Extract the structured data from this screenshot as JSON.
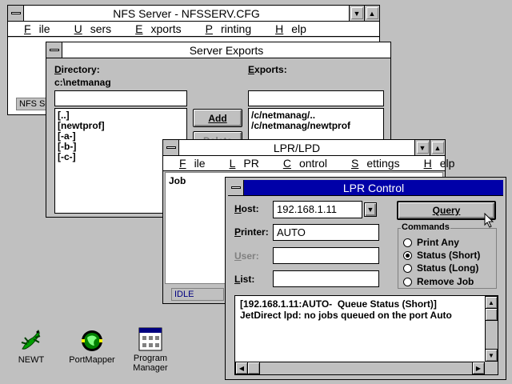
{
  "nfs": {
    "title": "NFS Server - NFSSERV.CFG",
    "menu": [
      "File",
      "Users",
      "Exports",
      "Printing",
      "Help"
    ],
    "status": "NFS Se"
  },
  "exports": {
    "title": "Server Exports",
    "directory_label": "Directory:",
    "directory_path": "c:\\netmanag",
    "directory_input": "",
    "exports_label": "Exports:",
    "exports_input": "",
    "directories": [
      "[..]",
      "[newtprof]",
      "[-a-]",
      "[-b-]",
      "[-c-]"
    ],
    "export_items": [
      "/c/netmanag/..",
      "/c/netmanag/newtprof"
    ],
    "add_label": "Add",
    "delete_label": "Delete"
  },
  "lpr": {
    "title": "LPR/LPD",
    "menu": [
      "File",
      "LPR",
      "Control",
      "Settings",
      "Help"
    ],
    "job_header": "Job",
    "status": "IDLE"
  },
  "control": {
    "title": "LPR Control",
    "host_label": "Host:",
    "host_value": "192.168.1.11",
    "printer_label": "Printer:",
    "printer_value": "AUTO",
    "user_label": "User:",
    "user_value": "",
    "list_label": "List:",
    "list_value": "",
    "query_label": "Query",
    "commands_label": "Commands",
    "commands": [
      {
        "label": "Print Any",
        "selected": false
      },
      {
        "label": "Status (Short)",
        "selected": true
      },
      {
        "label": "Status (Long)",
        "selected": false
      },
      {
        "label": "Remove Job",
        "selected": false
      }
    ],
    "output": [
      "[192.168.1.11:AUTO-  Queue Status (Short)]",
      "JetDirect lpd: no jobs queued on the port Auto"
    ]
  },
  "desktop_icons": [
    {
      "label": "NEWT",
      "icon": "newt-lizard-icon"
    },
    {
      "label": "PortMapper",
      "icon": "portmapper-icon"
    },
    {
      "label": "Program\nManager",
      "icon": "program-manager-icon"
    }
  ]
}
